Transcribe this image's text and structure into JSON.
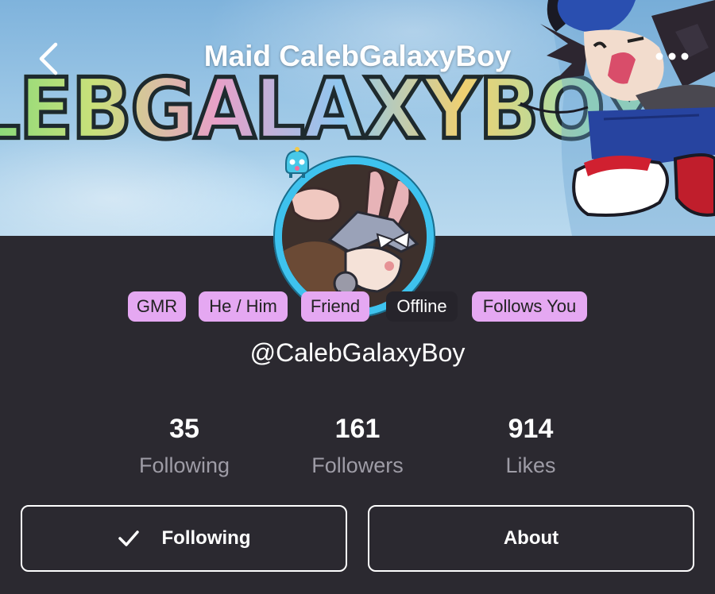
{
  "header": {
    "title": "Maid CalebGalaxyBoy",
    "back_icon": "chevron-left-icon",
    "more_icon": "more-horizontal-icon"
  },
  "banner": {
    "text": "LEBGALAXYBOY",
    "sky_color": "#9cc7e6"
  },
  "tags": [
    {
      "label": "GMR",
      "color": "#e5a8f2"
    },
    {
      "label": "He / Him",
      "color": "#e5a8f2"
    },
    {
      "label": "Friend",
      "color": "#e5a8f2"
    },
    {
      "label": "Offline",
      "color": "#26242b"
    },
    {
      "label": "Follows You",
      "color": "#e5a8f2"
    }
  ],
  "profile": {
    "handle": "@CalebGalaxyBoy",
    "avatar_ring_color": "#3ec2ee"
  },
  "stats": [
    {
      "value": "35",
      "label": "Following"
    },
    {
      "value": "161",
      "label": "Followers"
    },
    {
      "value": "914",
      "label": "Likes"
    }
  ],
  "actions": {
    "following_label": "Following",
    "following_icon": "check-icon",
    "about_label": "About"
  },
  "colors": {
    "background": "#2b2930",
    "tag": "#e5a8f2",
    "stat_label": "#9e9ca6"
  }
}
